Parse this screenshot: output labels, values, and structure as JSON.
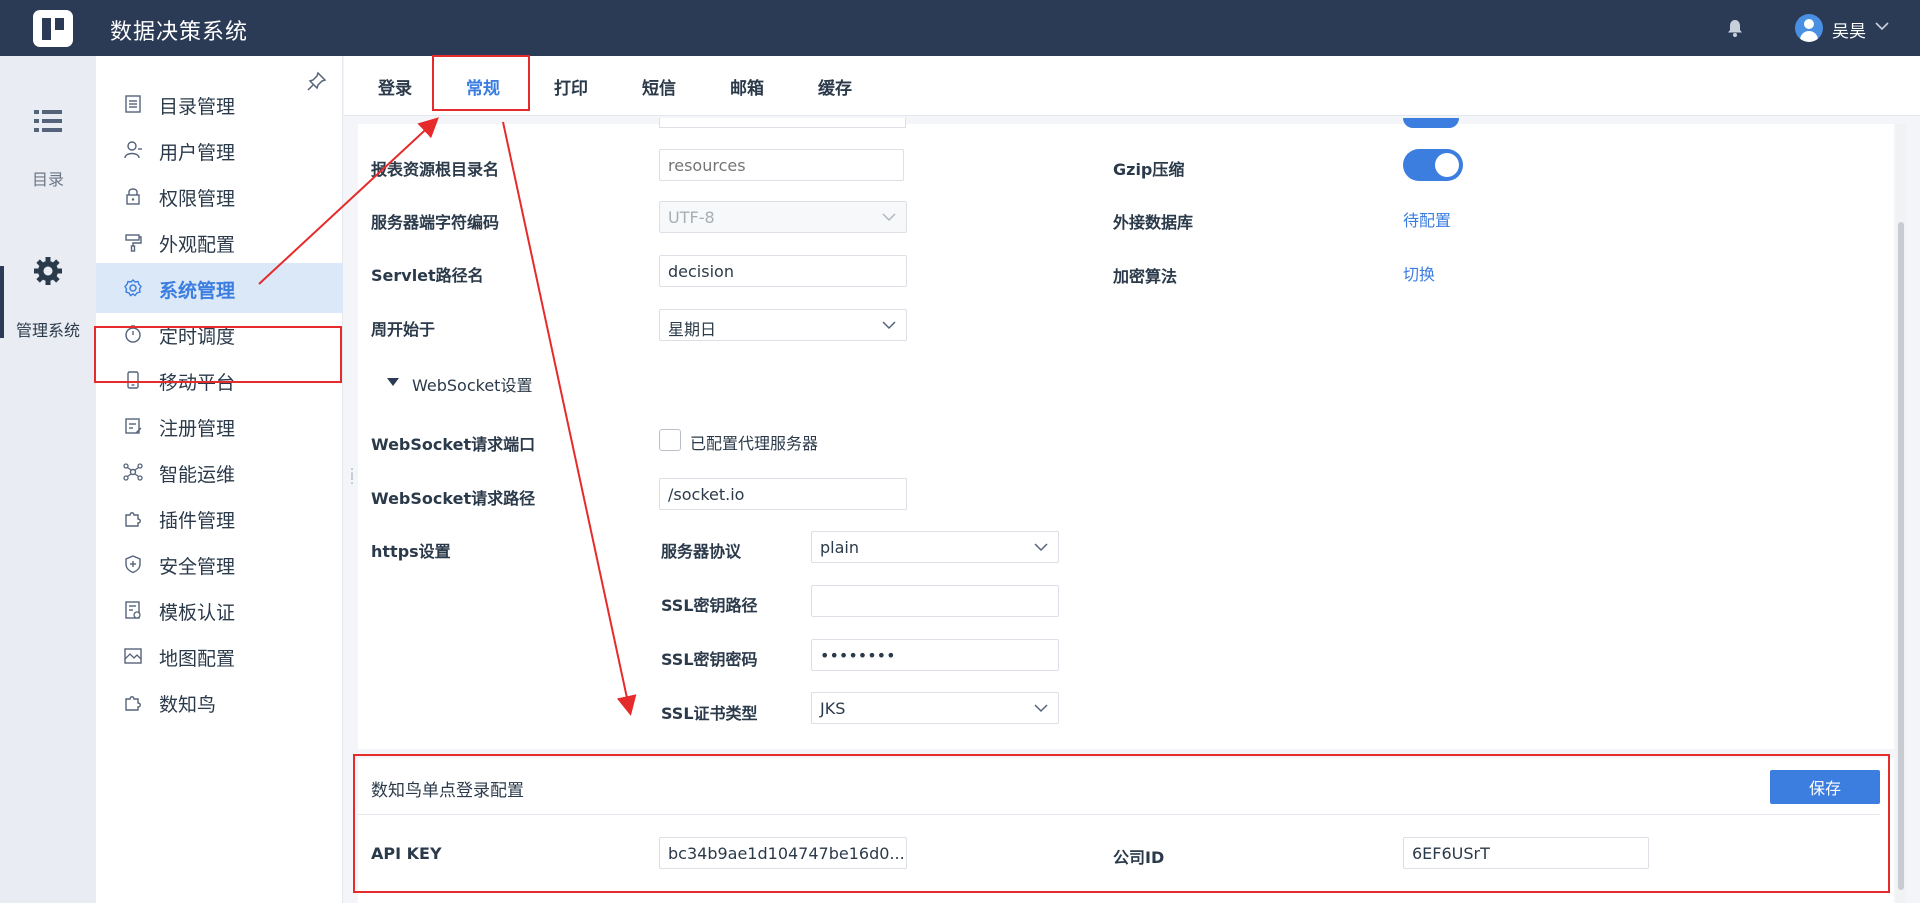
{
  "app": {
    "title": "数据决策系统"
  },
  "user": {
    "name": "吴昊"
  },
  "rail": {
    "catalog_label": "目录",
    "system_label": "管理系统"
  },
  "sidebar": {
    "items": [
      {
        "label": "目录管理",
        "icon": "catalog-icon"
      },
      {
        "label": "用户管理",
        "icon": "user-icon"
      },
      {
        "label": "权限管理",
        "icon": "lock-icon"
      },
      {
        "label": "外观配置",
        "icon": "paint-roller-icon"
      },
      {
        "label": "系统管理",
        "icon": "gear-icon"
      },
      {
        "label": "定时调度",
        "icon": "timer-icon"
      },
      {
        "label": "移动平台",
        "icon": "mobile-icon"
      },
      {
        "label": "注册管理",
        "icon": "register-icon"
      },
      {
        "label": "智能运维",
        "icon": "network-icon"
      },
      {
        "label": "插件管理",
        "icon": "puzzle-icon"
      },
      {
        "label": "安全管理",
        "icon": "shield-icon"
      },
      {
        "label": "模板认证",
        "icon": "template-icon"
      },
      {
        "label": "地图配置",
        "icon": "map-icon"
      },
      {
        "label": "数知鸟",
        "icon": "puzzle-icon"
      }
    ]
  },
  "tabs": [
    "登录",
    "常规",
    "打印",
    "短信",
    "邮箱",
    "缓存"
  ],
  "form": {
    "resources_label": "报表资源根目录名",
    "resources_placeholder": "resources",
    "charset_label": "服务器端字符编码",
    "charset_value": "UTF-8",
    "servlet_label": "Servlet路径名",
    "servlet_value": "decision",
    "week_label": "周开始于",
    "week_value": "星期日",
    "websocket_section": "WebSocket设置",
    "ws_port_label": "WebSocket请求端口",
    "ws_proxy_label": "已配置代理服务器",
    "ws_path_label": "WebSocket请求路径",
    "ws_path_value": "/socket.io",
    "https_label": "https设置",
    "protocol_label": "服务器协议",
    "protocol_value": "plain",
    "ssl_path_label": "SSL密钥路径",
    "ssl_path_value": "",
    "ssl_password_label": "SSL密钥密码",
    "ssl_password_value": "••••••••",
    "ssl_cert_label": "SSL证书类型",
    "ssl_cert_value": "JKS",
    "gzip_label": "Gzip压缩",
    "gzip_on": true,
    "external_db_label": "外接数据库",
    "external_db_link": "待配置",
    "encrypt_label": "加密算法",
    "encrypt_link": "切换"
  },
  "sso": {
    "title": "数知鸟单点登录配置",
    "save_label": "保存",
    "api_key_label": "API KEY",
    "api_key_value": "bc34b9ae1d104747be16d0...",
    "company_id_label": "公司ID",
    "company_id_value": "6EF6USrT"
  },
  "colors": {
    "accent": "#3c7de0",
    "header": "#2b3a55",
    "highlight": "#e52b2b"
  }
}
